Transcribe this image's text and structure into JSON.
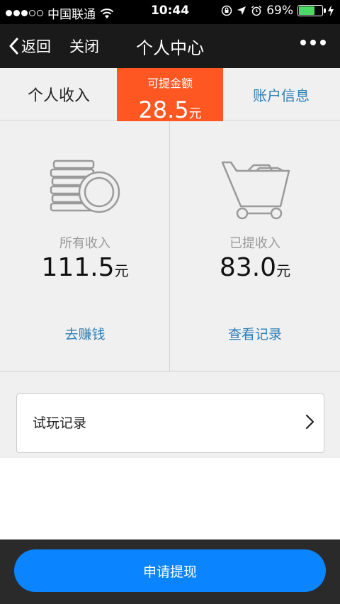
{
  "status_bar": {
    "carrier": "中国联通",
    "time": "10:44",
    "battery": "69%",
    "battery_level": 0.69
  },
  "nav": {
    "back_label": "返回",
    "close_label": "关闭",
    "title": "个人中心"
  },
  "header": {
    "tab_income": "个人收入",
    "tab_account": "账户信息"
  },
  "withdrawable": {
    "label": "可提金额",
    "amount": "28.5",
    "unit": "元",
    "color": "#ff5722"
  },
  "stats": {
    "all_income": {
      "label": "所有收入",
      "amount": "111.5",
      "unit": "元",
      "link": "去赚钱",
      "icon": "coin-stack-icon"
    },
    "withdrawn": {
      "label": "已提收入",
      "amount": "83.0",
      "unit": "元",
      "link": "查看记录",
      "icon": "shopping-cart-icon"
    }
  },
  "record": {
    "label": "试玩记录"
  },
  "apply_button": {
    "label": "申请提现"
  },
  "colors": {
    "accent_blue": "#0a84ff",
    "link_blue": "#2f7fb8",
    "ribbon_orange": "#ff5722"
  }
}
